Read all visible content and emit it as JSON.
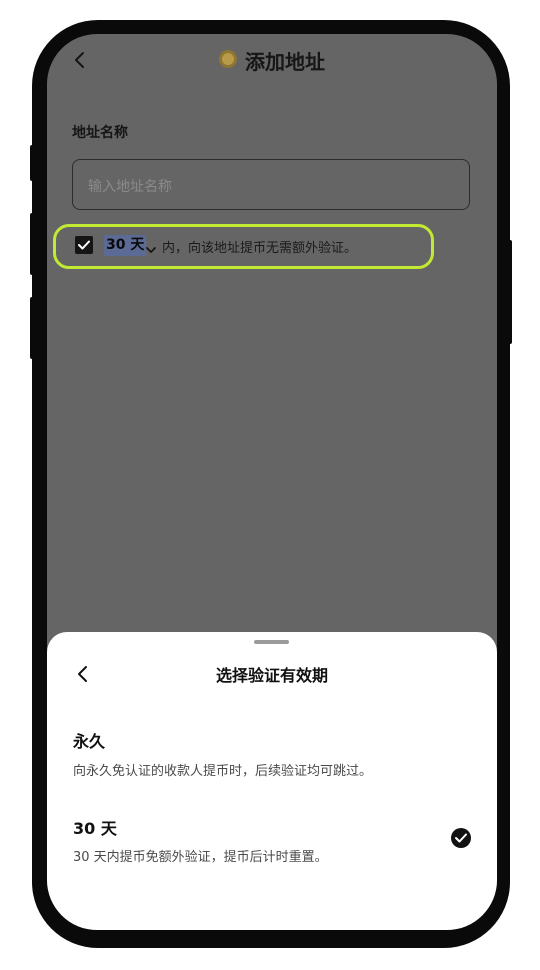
{
  "header": {
    "title": "添加地址",
    "back_icon": "chevron-left-icon",
    "title_icon": "coin-icon"
  },
  "form": {
    "name_label": "地址名称",
    "name_placeholder": "输入地址名称",
    "remember_checked": true,
    "days_value": "30 天",
    "condition_text": "内，向该地址提币无需额外验证。"
  },
  "sheet": {
    "title": "选择验证有效期",
    "options": [
      {
        "title": "永久",
        "desc": "向永久免认证的收款人提币时，后续验证均可跳过。",
        "selected": false
      },
      {
        "title": "30 天",
        "desc": "30 天内提币免额外验证，提币后计时重置。",
        "selected": true
      }
    ]
  },
  "colors": {
    "highlight": "#c3ea33",
    "overlay": "#656565",
    "selection": "#5c6a96"
  }
}
